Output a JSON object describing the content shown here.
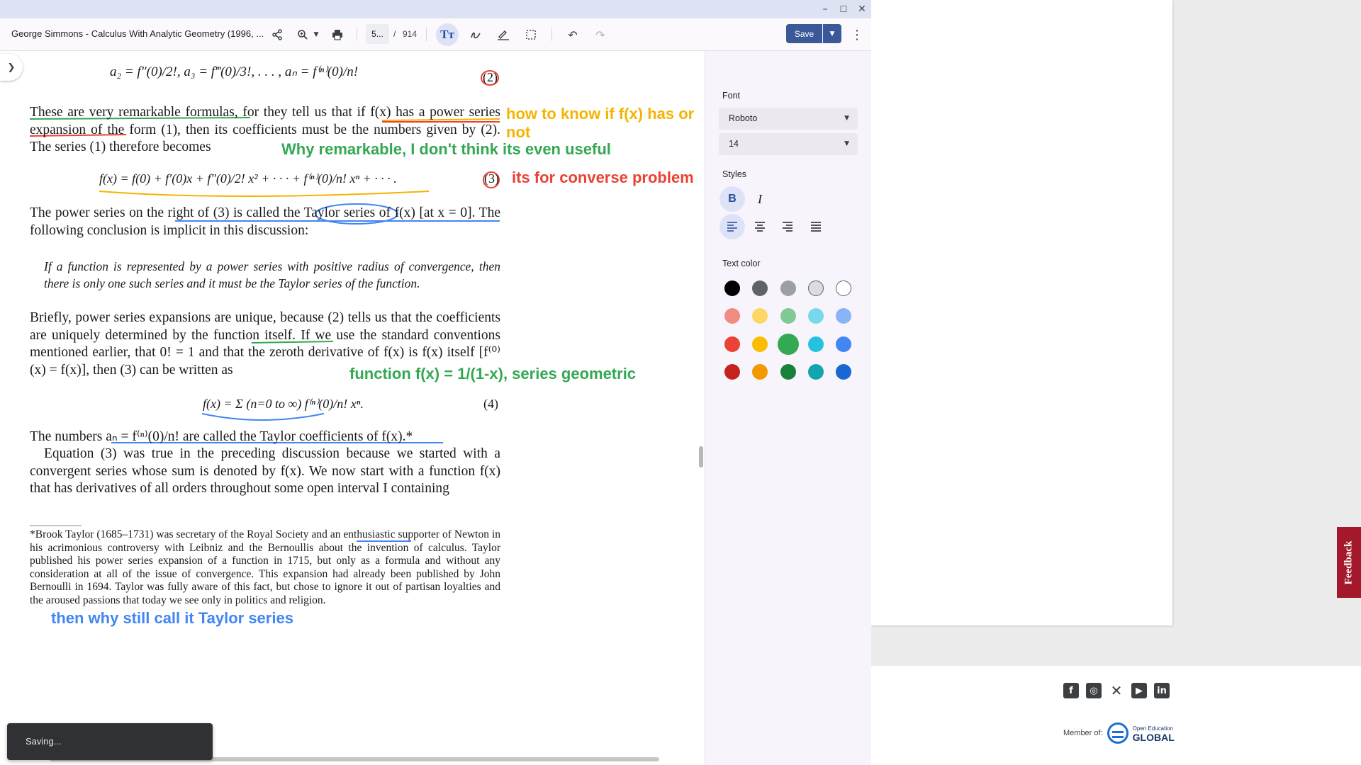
{
  "window": {
    "doc_title": "George Simmons - Calculus With Analytic Geometry (1996, ...",
    "page_current": "5...",
    "page_separator": "/",
    "page_total": "914",
    "save_label": "Save",
    "text_tool_label": "Tт"
  },
  "document": {
    "formula_2": "a₂ = f″(0)/2!,   a₃ = f‴(0)/3!,   . . . ,   aₙ = f⁽ⁿ⁾(0)/n!",
    "eq2_label": "(2)",
    "para1": "These are very remarkable formulas, for they tell us that if f(x) has a power series expansion of the form (1), then its coefficients must be the numbers given by (2). The series (1) therefore becomes",
    "formula_3": "f(x) = f(0) + f′(0)x + f″(0)/2! x² + · · · + f⁽ⁿ⁾(0)/n! xⁿ + · · · .",
    "eq3_label": "(3)",
    "para2": "The power series on the right of (3) is called the Taylor series of f(x) [at x = 0]. The following conclusion is implicit in this discussion:",
    "para3": "If a function is represented by a power series with positive radius of convergence, then there is only one such series and it must be the Taylor series of the function.",
    "para4": "Briefly, power series expansions are unique, because (2) tells us that the coefficients are uniquely determined by the function itself. If we use the standard conventions mentioned earlier, that 0! = 1 and that the zeroth derivative of f(x) is f(x) itself [f⁽⁰⁾(x) = f(x)], then (3) can be written as",
    "formula_4": "f(x) = Σ (n=0 to ∞) f⁽ⁿ⁾(0)/n! xⁿ.",
    "eq4_label": "(4)",
    "para5": "The numbers aₙ = f⁽ⁿ⁾(0)/n! are called the Taylor coefficients of f(x).*",
    "para6": "Equation (3) was true in the preceding discussion because we started with a convergent series whose sum is denoted by f(x). We now start with a function f(x) that has derivatives of all orders throughout some open interval I containing",
    "footnote": "*Brook Taylor (1685–1731) was secretary of the Royal Society and an enthusiastic supporter of Newton in his acrimonious controversy with Leibniz and the Bernoullis about the invention of calculus. Taylor published his power series expansion of a function in 1715, but only as a formula and without any consideration at all of the issue of convergence. This expansion had already been published by John Bernoulli in 1694. Taylor was fully aware of this fact, but chose to ignore it out of partisan loyalties and the aroused passions that today we see only in politics and religion."
  },
  "annotations": {
    "note1_line1": "how to know if f(x) has or",
    "note1_line2": "not",
    "note2": "Why remarkable, I don't think its even useful",
    "note3": "its for converse problem",
    "note4": "function f(x) = 1/(1-x), series geometric",
    "note5": "then why still call it Taylor series",
    "colors": {
      "yellow": "#f4b400",
      "green": "#34a853",
      "red": "#e94235",
      "blue": "#4285f4"
    }
  },
  "panel": {
    "font_label": "Font",
    "font_value": "Roboto",
    "size_value": "14",
    "styles_label": "Styles",
    "bold_label": "B",
    "italic_label": "I",
    "text_color_label": "Text color",
    "swatches": [
      [
        "#000000",
        "#5f6368",
        "#9aa0a6",
        "#dadce0",
        "#ffffff"
      ],
      [
        "#f28b82",
        "#fdd663",
        "#81c995",
        "#78d9ec",
        "#8ab4f8"
      ],
      [
        "#ea4335",
        "#fbbc04",
        "#34a853",
        "#24c1e0",
        "#4285f4"
      ],
      [
        "#c5221f",
        "#f29900",
        "#188038",
        "#12a4af",
        "#1967d2"
      ]
    ],
    "selected_swatch": "#34a853"
  },
  "toast": {
    "text": "Saving..."
  },
  "background_page": {
    "feedback_label": "Feedback",
    "member_text": "Member of:",
    "org_name": "GLOBAL",
    "org_subtitle": "Open Education",
    "social_icons": [
      "facebook-icon",
      "instagram-icon",
      "x-icon",
      "youtube-icon",
      "linkedin-icon"
    ]
  }
}
